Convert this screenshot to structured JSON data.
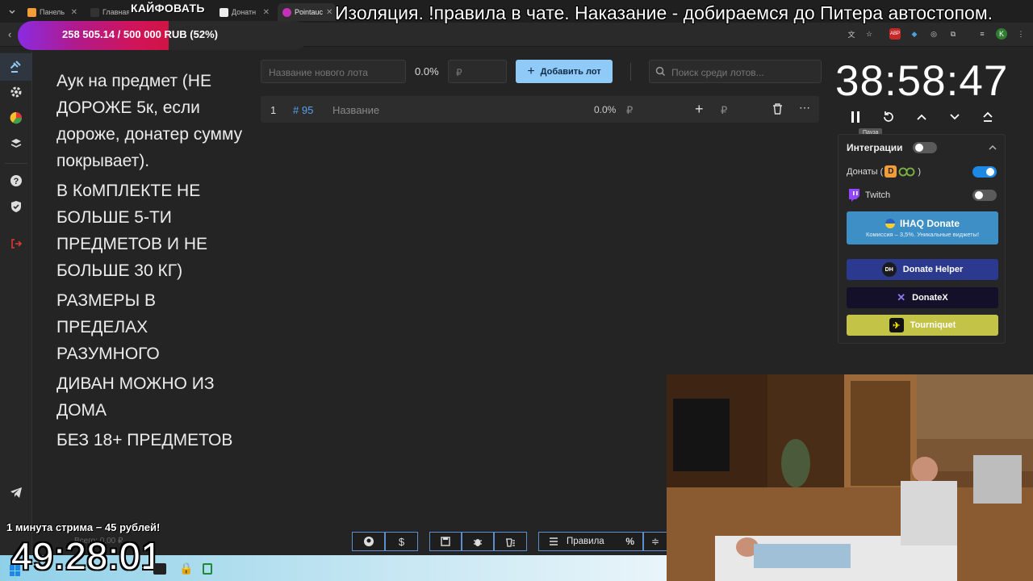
{
  "browser": {
    "tabs": [
      {
        "label": "Панель",
        "color": "#f29d38"
      },
      {
        "label": "Главная",
        "color": "#333333"
      },
      {
        "label": "Донатн",
        "color": "#1a1a1a"
      },
      {
        "label": "Pointauc",
        "color": "#c62fb8"
      }
    ]
  },
  "overlay": {
    "channel": "КАЙФОВАТЬ",
    "ticker": "Изоляция. !правила в чате. Наказание - добираемся до Питера автостопом.",
    "goal": "258 505.14 / 500 000 RUB (52%)",
    "goal_percent": 52,
    "minute_promo": "1 минута стрима − 45 рублей!",
    "big_clock": "49:28:01"
  },
  "rules": [
    "Аук на предмет (НЕ ДОРОЖЕ 5к, если дороже, донатер сумму покрывает).",
    "В КоМПЛЕКТЕ НЕ БОЛЬШЕ 5-ТИ ПРЕДМЕТОВ И НЕ БОЛЬШЕ 30 КГ)",
    "РАЗМЕРЫ В ПРЕДЕЛАХ РАЗУМНОГО",
    "ДИВАН МОЖНО ИЗ ДОМА",
    "БЕЗ 18+ ПРЕДМЕТОВ"
  ],
  "toolbar": {
    "new_lot_placeholder": "Название нового лота",
    "percent": "0.0%",
    "currency": "₽",
    "add_lot": "Добавить лот",
    "search_placeholder": "Поиск среди лотов..."
  },
  "lots": [
    {
      "index": "1",
      "id": "# 95",
      "name": "Название",
      "percent": "0.0%",
      "currency": "₽"
    }
  ],
  "timer": {
    "value": "38:58:47",
    "pause_tooltip": "Пауза"
  },
  "integrations": {
    "title": "Интеграции",
    "donations_label": "Донаты (",
    "donations_suffix": ")",
    "twitch_label": "Twitch",
    "ihaq_title": "IHAQ Donate",
    "ihaq_sub": "Комиссия – 3,5%. Уникальные виджеты!",
    "donate_helper": "Donate Helper",
    "donatex": "DonateX",
    "tourniquet": "Tourniquet",
    "donations_enabled": true,
    "twitch_enabled": false,
    "master_enabled": false
  },
  "footer": {
    "total": "Всего: 0,00 ₽",
    "rules_button": "Правила"
  },
  "colors": {
    "accent": "#90caf9",
    "toggle_on": "#1e88e5",
    "ihaq_bg": "#3d8fc6",
    "donate_helper_bg": "#2b3a8f",
    "donatex_bg": "#14102a",
    "tourniquet_bg": "#c3c447",
    "logout": "#e53935"
  }
}
